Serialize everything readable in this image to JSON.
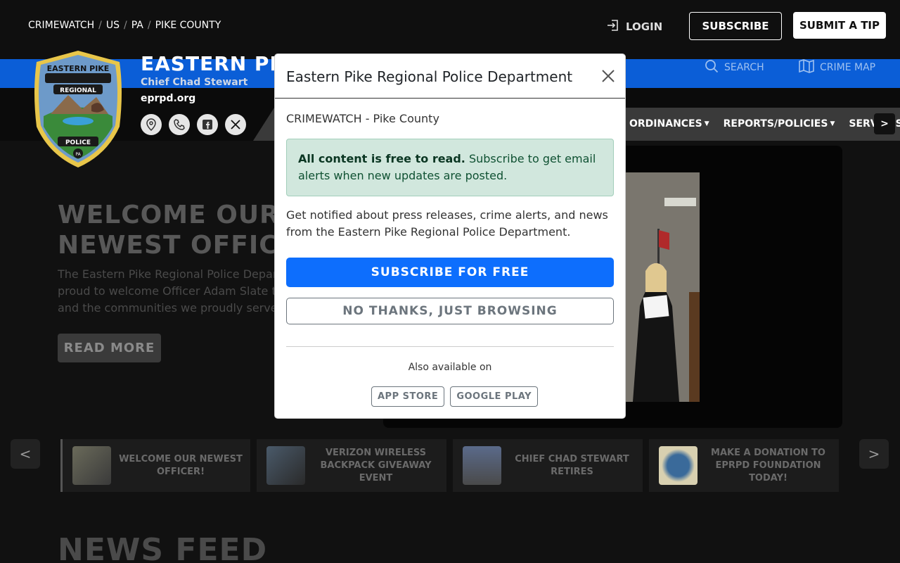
{
  "topbar": {
    "breadcrumb": [
      "CRIMEWATCH",
      "US",
      "PA",
      "PIKE COUNTY"
    ],
    "login_label": "LOGIN",
    "subscribe_label": "SUBSCRIBE",
    "tip_label": "SUBMIT A TIP"
  },
  "header": {
    "title": "EASTERN PIKE",
    "chief": "Chief Chad Stewart",
    "domain": "eprpd.org",
    "search_label": "SEARCH",
    "crimemap_label": "CRIME MAP",
    "nav": [
      "ORDINANCES",
      "REPORTS/POLICIES",
      "SERVICES"
    ],
    "nav_next": ">",
    "logo_text": [
      "EASTERN PIKE",
      "REGIONAL",
      "POLICE",
      "PA"
    ]
  },
  "hero": {
    "title_line1": "WELCOME OUR",
    "title_line2": "NEWEST OFFICE",
    "text": "The Eastern Pike Regional Police Depar proud to welcome Officer Adam Slate t and the communities we proudly serve",
    "read_more": "READ MORE"
  },
  "carousel": {
    "prev": "<",
    "next": ">",
    "items": [
      {
        "label": "WELCOME OUR NEWEST OFFICER!"
      },
      {
        "label": "VERIZON WIRELESS BACKPACK GIVEAWAY EVENT"
      },
      {
        "label": "CHIEF CHAD STEWART RETIRES"
      },
      {
        "label": "MAKE A DONATION TO EPRPD FOUNDATION TODAY!"
      }
    ]
  },
  "newsfeed_title": "NEWS FEED",
  "modal": {
    "title": "Eastern Pike Regional Police Department",
    "subtitle": "CRIMEWATCH - Pike County",
    "alert_bold": "All content is free to read.",
    "alert_text": " Subscribe to get email alerts when new updates are posted.",
    "description": "Get notified about press releases, crime alerts, and news from the Eastern Pike Regional Police Department.",
    "subscribe_free": "SUBSCRIBE FOR FREE",
    "no_thanks": "NO THANKS, JUST BROWSING",
    "also_available": "Also available on",
    "app_store": "APP STORE",
    "google_play": "GOOGLE PLAY"
  },
  "colors": {
    "brand_blue": "#0b5ed7",
    "button_blue": "#0d6efd",
    "alert_green": "#d1e7dd"
  }
}
